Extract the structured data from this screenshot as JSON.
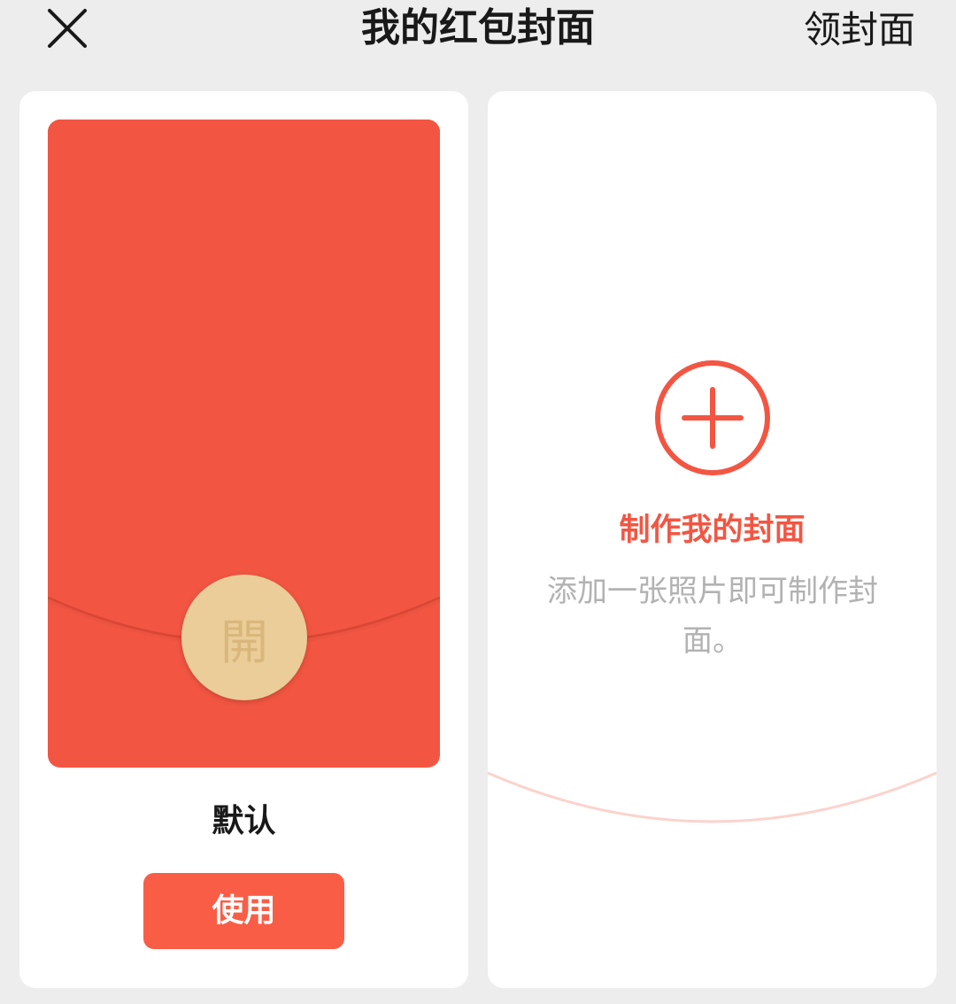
{
  "header": {
    "title": "我的红包封面",
    "get_cover_label": "领封面",
    "close_icon": "close-icon"
  },
  "default_cover": {
    "seal_char": "開",
    "name": "默认",
    "use_label": "使用",
    "envelope_color": "#f25643",
    "seal_color": "#eacd98"
  },
  "make_cover": {
    "icon": "plus-circle-icon",
    "title": "制作我的封面",
    "description": "添加一张照片即可制作封面。",
    "accent_color": "#f25643"
  }
}
